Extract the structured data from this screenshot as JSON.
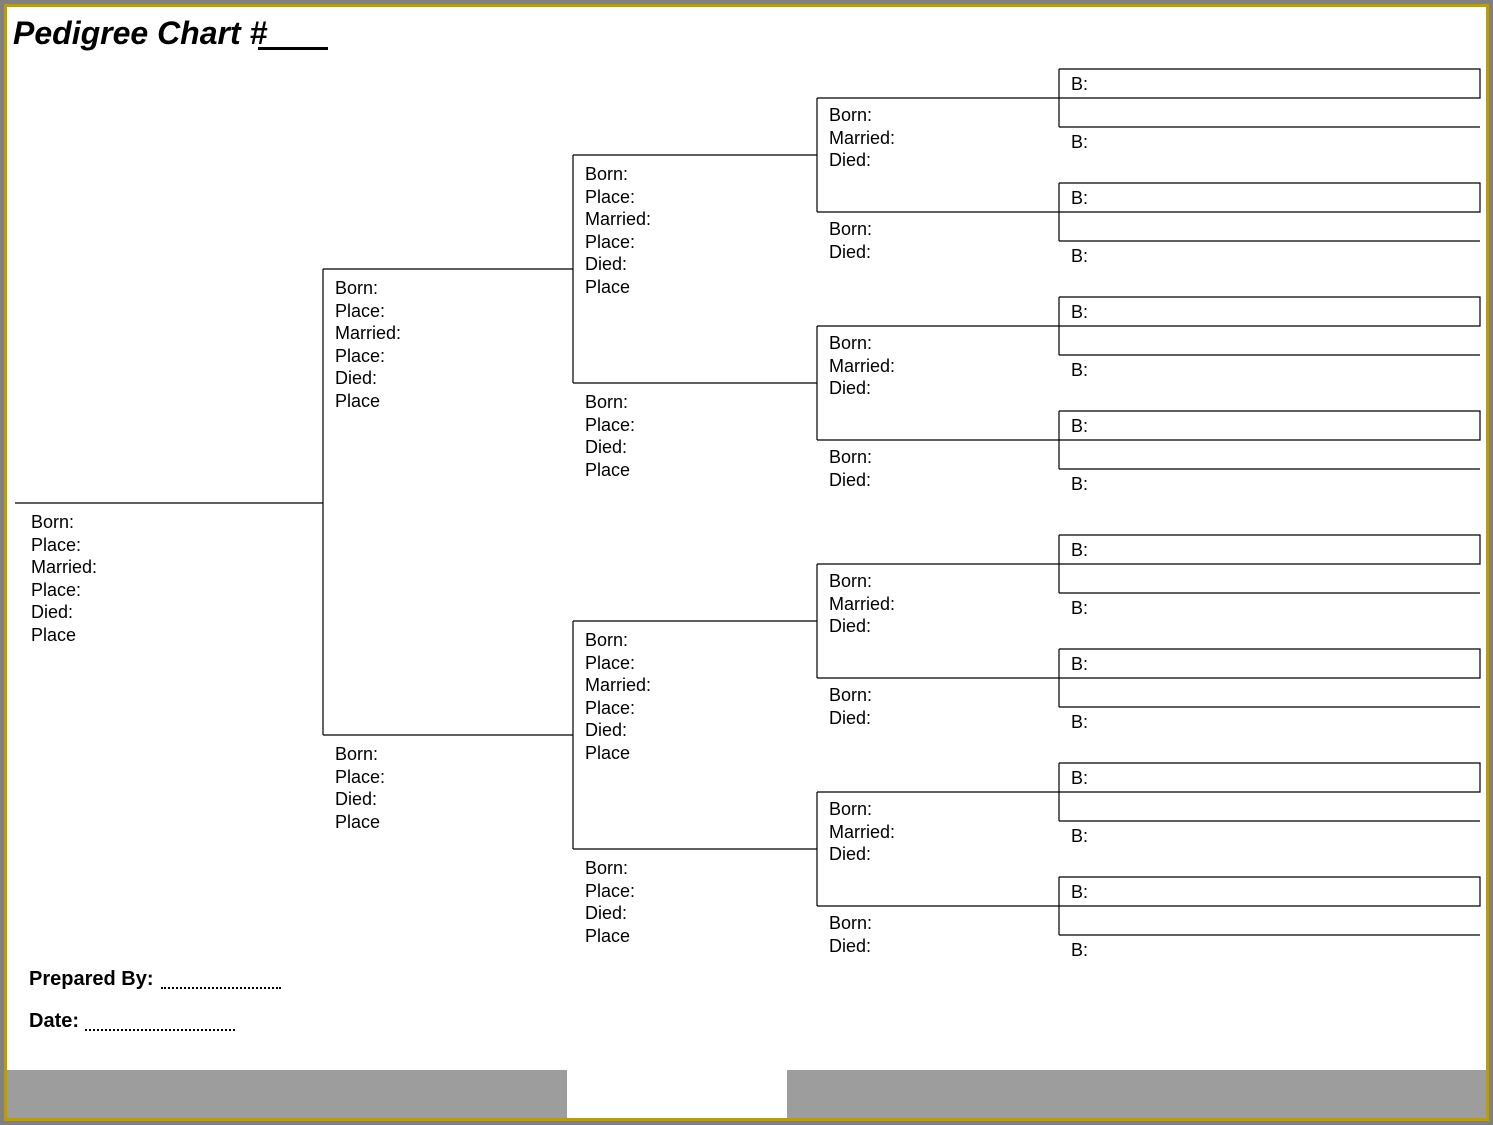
{
  "title": "Pedigree Chart #",
  "preparedBy": "Prepared By:",
  "dateLabel": "Date:",
  "gen1": {
    "p1": "Born:\nPlace:\nMarried:\nPlace:\nDied:\nPlace"
  },
  "gen2": {
    "p1": "Born:\nPlace:\nMarried:\nPlace:\nDied:\nPlace",
    "p2": "Born:\nPlace:\nDied:\nPlace"
  },
  "gen3": {
    "p1": "Born:\nPlace:\nMarried:\nPlace:\nDied:\nPlace",
    "p2": "Born:\nPlace:\nDied:\nPlace",
    "p3": "Born:\nPlace:\nMarried:\nPlace:\nDied:\nPlace",
    "p4": "Born:\nPlace:\nDied:\nPlace"
  },
  "gen4": {
    "p1": "Born:\nMarried:\nDied:",
    "p2": "Born:\nDied:",
    "p3": "Born:\nMarried:\nDied:",
    "p4": "Born:\nDied:",
    "p5": "Born:\nMarried:\nDied:",
    "p6": "Born:\nDied:",
    "p7": "Born:\nMarried:\nDied:",
    "p8": "Born:\nDied:"
  },
  "gen5": {
    "b1": "B:",
    "b2": "B:",
    "b3": "B:",
    "b4": "B:",
    "b5": "B:",
    "b6": "B:",
    "b7": "B:",
    "b8": "B:",
    "b9": "B:",
    "b10": "B:",
    "b11": "B:",
    "b12": "B:",
    "b13": "B:",
    "b14": "B:",
    "b15": "B:",
    "b16": "B:"
  }
}
